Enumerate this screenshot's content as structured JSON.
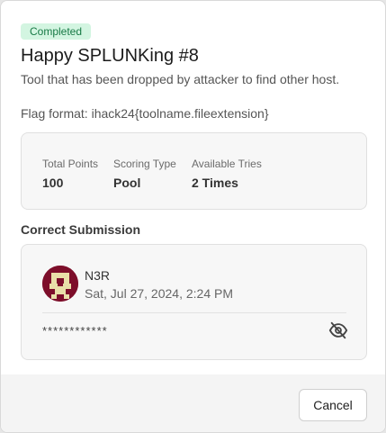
{
  "status_badge": "Completed",
  "challenge": {
    "title": "Happy SPLUNKing #8",
    "description": "Tool that has been dropped by attacker to find other host.",
    "flag_format": "Flag format: ihack24{toolname.fileextension}"
  },
  "stats": [
    {
      "label": "Total Points",
      "value": "100"
    },
    {
      "label": "Scoring Type",
      "value": "Pool"
    },
    {
      "label": "Available Tries",
      "value": "2 Times"
    }
  ],
  "correct_submission": {
    "heading": "Correct Submission",
    "user": "N3R",
    "date": "Sat, Jul 27, 2024, 2:24 PM",
    "flag_masked": "************",
    "toggle_icon": "eye-slash-icon"
  },
  "footer": {
    "cancel_label": "Cancel"
  },
  "colors": {
    "badge_bg": "#d3f5e1",
    "badge_text": "#187a46",
    "avatar_bg": "#7d0e2a",
    "avatar_fg": "#e9dfa8"
  }
}
